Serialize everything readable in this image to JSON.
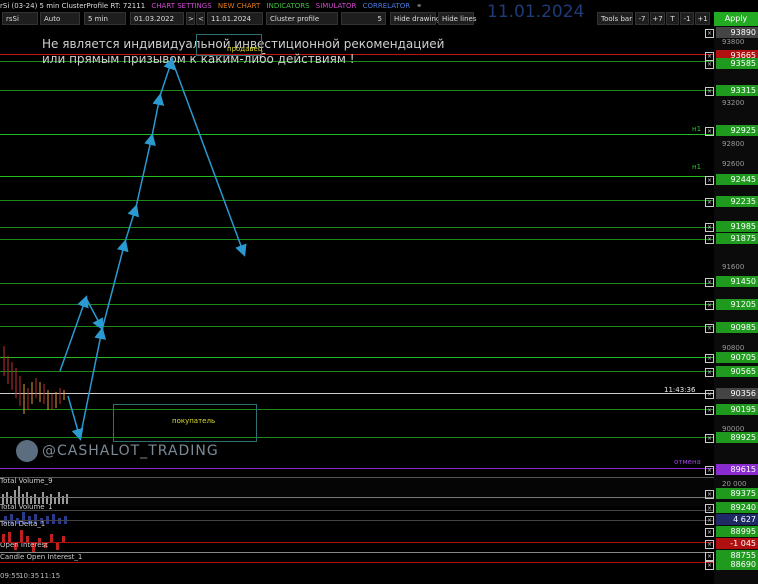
{
  "title_bar": {
    "instrument": "rSi (03-24) 5 min ClusterProfile RT: 72111",
    "menu": [
      "CHART SETTINGS",
      "NEW CHART",
      "INDICATORS",
      "SIMULATOR",
      "CORRELATOR"
    ],
    "menu_colors": [
      "#d04ad0",
      "#e07a1e",
      "#40c040",
      "#d04ad0",
      "#4a7ae0"
    ]
  },
  "toolbar": {
    "symbol": "rsSi",
    "mode": "Auto",
    "interval": "5 min",
    "date_from": "01.03.2022",
    "nav_next": ">",
    "nav_prev": "<",
    "date_to": "11.01.2024",
    "profile": "Cluster profile",
    "profile_value": "5",
    "hide_drawing": "Hide drawing",
    "hide_lines": "Hide lines",
    "big_date": "11.01.2024",
    "tools_bar": "Tools bar",
    "step_buttons": [
      "-7",
      "+7",
      "T",
      "-1",
      "+1"
    ],
    "apply": "Apply"
  },
  "disclaimer": {
    "line1": "Не является индивидуальной инвестиционной рекомендацией",
    "line2": "или прямым призывом к каким-либо действиям !"
  },
  "annotations": {
    "seller": "продавец",
    "buyer": "покупатель",
    "cancel": "отмена",
    "h1_a": "н1",
    "h1_b": "н1",
    "crosshair_time": "11:43:36"
  },
  "watermark": "@CASHALOT_TRADING",
  "price_axis": [
    "93800",
    "93200",
    "92800",
    "92600",
    "91600",
    "90800",
    "90000",
    "20 000"
  ],
  "price_tags": [
    {
      "value": "93890",
      "color": "#444444"
    },
    {
      "value": "93665",
      "color": "#b01010"
    },
    {
      "value": "93585",
      "color": "#1f9a1f"
    },
    {
      "value": "93315",
      "color": "#1f9a1f"
    },
    {
      "value": "92925",
      "color": "#1f9a1f"
    },
    {
      "value": "92445",
      "color": "#1f9a1f"
    },
    {
      "value": "92235",
      "color": "#1f9a1f"
    },
    {
      "value": "91985",
      "color": "#1f9a1f"
    },
    {
      "value": "91875",
      "color": "#1f9a1f"
    },
    {
      "value": "91450",
      "color": "#1f9a1f"
    },
    {
      "value": "91205",
      "color": "#1f9a1f"
    },
    {
      "value": "90985",
      "color": "#1f9a1f"
    },
    {
      "value": "90705",
      "color": "#1f9a1f"
    },
    {
      "value": "90565",
      "color": "#1f9a1f"
    },
    {
      "value": "90356",
      "color": "#444444"
    },
    {
      "value": "90195",
      "color": "#1f9a1f"
    },
    {
      "value": "89925",
      "color": "#1f9a1f"
    },
    {
      "value": "89615",
      "color": "#8a2bd0"
    },
    {
      "value": "89375",
      "color": "#1f9a1f"
    },
    {
      "value": "89240",
      "color": "#1f9a1f"
    },
    {
      "value": "4 627",
      "color": "#1d2a66"
    },
    {
      "value": "88995",
      "color": "#1f9a1f"
    },
    {
      "value": "-1 045",
      "color": "#b01010"
    },
    {
      "value": "88755",
      "color": "#1f9a1f"
    },
    {
      "value": "88690",
      "color": "#1f9a1f"
    }
  ],
  "indicators": {
    "volume9": "Total Volume_9",
    "volume1": "Total Volume_1",
    "delta": "Total Delta_1",
    "oi": "Open Interest",
    "candle_oi": "Candle Open Interest_1"
  },
  "time_axis": [
    "09:55",
    "10:35",
    "11:15"
  ]
}
